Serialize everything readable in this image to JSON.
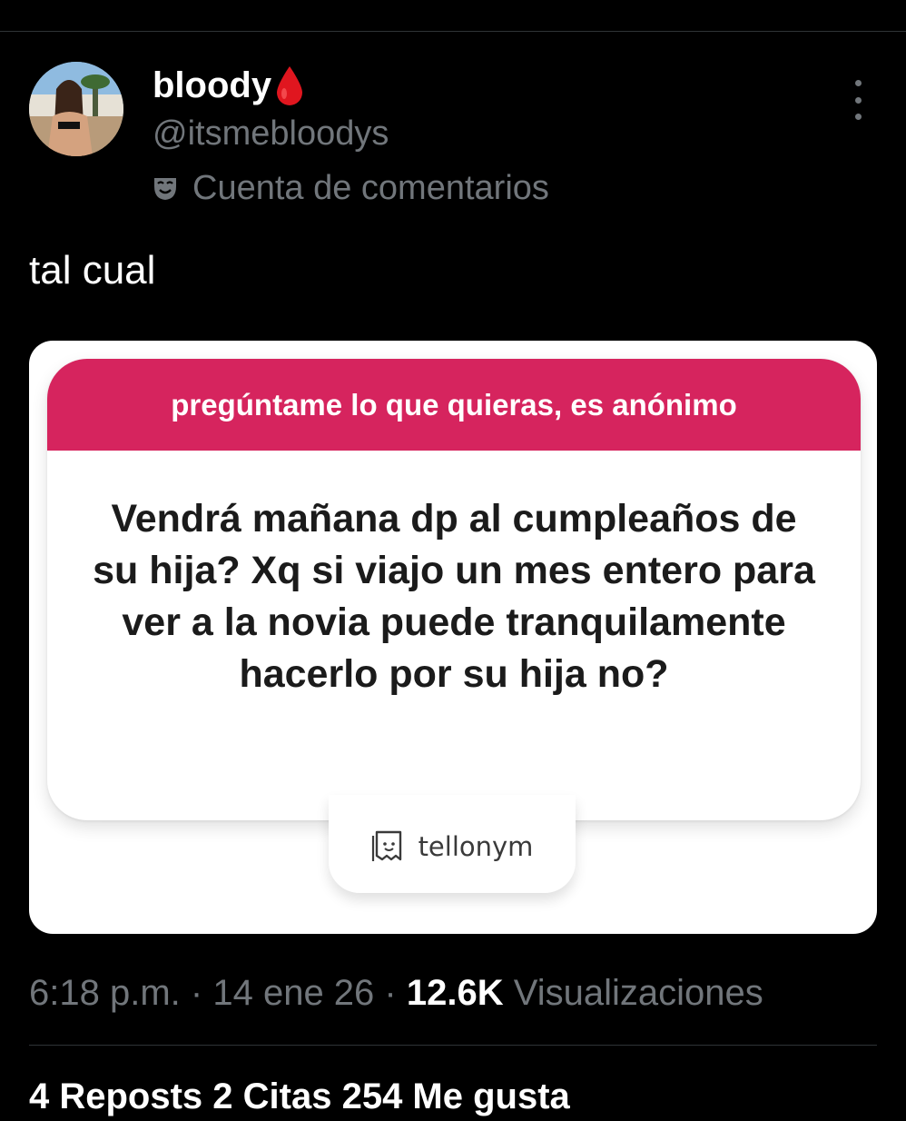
{
  "author": {
    "display_name": "bloody",
    "handle": "@itsmebloodys",
    "account_label": "Cuenta de comentarios",
    "name_emoji_icon": "blood-drop-icon",
    "label_icon": "theater-mask-icon"
  },
  "tweet": {
    "text": "tal cual",
    "more_icon": "more-vertical-icon"
  },
  "embedded_image": {
    "header": "pregúntame lo que quieras, es anónimo",
    "question": "Vendrá mañana dp al cumpleaños de su hija? Xq si viajo un mes entero para ver a la novia puede tranquilamente hacerlo por su hija no?",
    "brand": "tellonym",
    "brand_icon": "tellonym-ghost-icon",
    "colors": {
      "header_bg": "#d6245e",
      "text": "#1b1b1b"
    }
  },
  "meta": {
    "time": "6:18 p.m.",
    "separator": "·",
    "date": "14 ene 26",
    "views_count": "12.6K",
    "views_label": "Visualizaciones"
  },
  "stats_row": {
    "text": "4 Reposts  2 Citas  254 Me gusta"
  },
  "colors": {
    "background": "#000000",
    "primary_text": "#e7e9ea",
    "secondary_text": "#71767b",
    "divider": "#2f3336",
    "drop_red": "#e0161f"
  }
}
